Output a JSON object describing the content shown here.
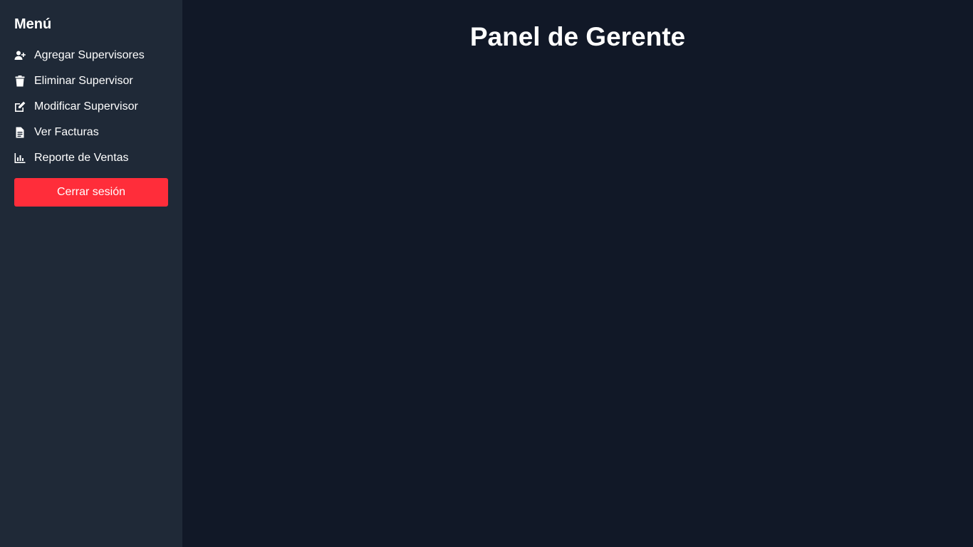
{
  "sidebar": {
    "title": "Menú",
    "items": [
      {
        "label": "Agregar Supervisores",
        "icon": "user-plus-icon"
      },
      {
        "label": "Eliminar Supervisor",
        "icon": "trash-icon"
      },
      {
        "label": "Modificar Supervisor",
        "icon": "edit-icon"
      },
      {
        "label": "Ver Facturas",
        "icon": "file-icon"
      },
      {
        "label": "Reporte de Ventas",
        "icon": "bar-chart-icon"
      }
    ],
    "logout_label": "Cerrar sesión"
  },
  "main": {
    "title": "Panel de Gerente"
  },
  "colors": {
    "sidebar_bg": "#1f2937",
    "main_bg": "#111827",
    "logout_bg": "#ff2d3a",
    "text": "#ffffff"
  }
}
